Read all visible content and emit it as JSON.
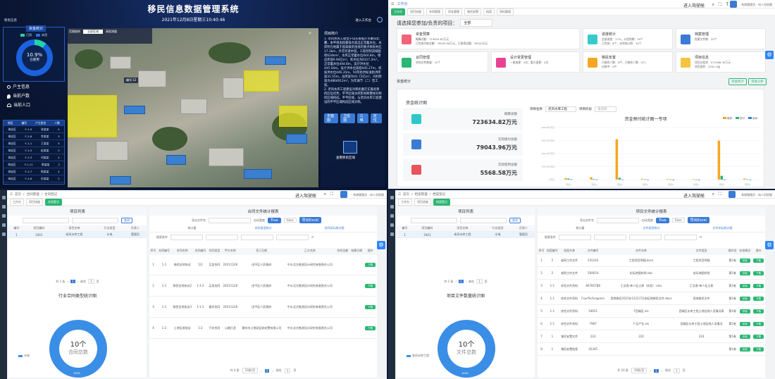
{
  "q1": {
    "title": "移民信息数据管理系统",
    "datetime": "2021年12月8日星期三10:40:46",
    "top_left": "移民信息",
    "top_right": "进入工作台",
    "fund_title": "资金统计",
    "legend_a": "已用",
    "legend_b": "未用",
    "pct": "10.9%",
    "pct_label": "已使用",
    "nav": [
      "户主信息",
      "当前户数",
      "当前人口"
    ],
    "table_head": [
      "地区",
      "编号",
      "户主姓名",
      "人数"
    ],
    "table_rows": [
      [
        "海淀区",
        "F-1-9",
        "张某某",
        "4"
      ],
      [
        "海淀区",
        "F-1-8",
        "李某某",
        "3"
      ],
      [
        "海淀区",
        "F-1-1",
        "王某某",
        "5"
      ],
      [
        "海淀区",
        "F-1-5",
        "赵某某",
        "3"
      ],
      [
        "海淀区",
        "F-1-3",
        "刘某某",
        "4"
      ],
      [
        "海淀区",
        "F-1-11",
        "陈某某",
        "2"
      ],
      [
        "海淀区",
        "F-1-7",
        "杨某某",
        "4"
      ],
      [
        "海淀区",
        "F-1-6",
        "孙某某",
        "3"
      ]
    ],
    "map_controls": [
      "范围图例",
      "全部区域",
      "高程测量"
    ],
    "map_label": "编号:12",
    "text_title": "项目简介",
    "text_body": "1. 老风水库工程位于山东省临沂市蒙山北麓，本平坝高程最低点高出正常蓄水位，水库所在地属于国家级贫困县的重点移民村庄17.3km，外完河道中游。工程控制流域面积624km²，水库正常蓄水位444.8m，相应库容0.94亿m³，死水位为6317.2m³，正常蓄水位444.8m，设计洪水位445.54m，设计洪水位高程445.27m，校核洪水位446.35m。50年防洪标准防洪库容31.55m，总库容为41.72亿m³，兴利库容为4864912m³，为年调节（二）型工程。\n2. 老风水库工程建设对移民搬迁实施北移的区位优势，平平区域水库影响和整体对称的区域构成，平平区域，与老风水库工程建设的平平区域构成区域对称。",
    "buttons": [
      "平面图",
      "卫星图",
      "三维",
      "定位"
    ],
    "bottom_btn": "查看移民区域"
  },
  "q2": {
    "header_right": "进入驾驶舱",
    "user": "系统管理员 · 向人员权限",
    "tabs": [
      "工作台",
      "项目进度",
      "合同管理",
      "资金管理",
      "移民安置",
      "档案",
      "资料管理"
    ],
    "select_label": "请选择您参加/负责的项目：",
    "select_value": "全部",
    "stat_cards": [
      {
        "title": "资金预算",
        "lines": [
          "概算总额：723634.82万元",
          "已完成付款总额：79043.96万元，已使用总额：39100万元"
        ],
        "color": "#f2637b"
      },
      {
        "title": "进度统计",
        "lines": [
          "全部进度：17%，计划到期：29个",
          "已完成：8个，未完成计划：34个"
        ],
        "color": "#36cbcb"
      },
      {
        "title": "档案管理",
        "lines": [
          "档案文件数：10个"
        ],
        "color": "#3a7bd5"
      },
      {
        "title": "合同管理",
        "lines": [
          "合同文件数量：10个"
        ],
        "color": "#2bb673"
      },
      {
        "title": "设计变更管理",
        "lines": [
          "一般变更：0次；重大变更：0次"
        ],
        "color": "#e84393"
      },
      {
        "title": "移民安置",
        "lines": [
          "已移民人数：0户，已移民人数：0人；",
          "迁移中：0户"
        ],
        "color": "#f5a623"
      },
      {
        "title": "项目信息",
        "lines": [
          "项目总投资：571066.30万元",
          "项目面积：2050.1亩"
        ],
        "color": "#f5c342"
      }
    ],
    "section": "资金统计",
    "section_tabs": [
      "资金统计",
      "资金分析"
    ],
    "panel_title": "资金统计图",
    "metrics": [
      {
        "label": "概算总额",
        "value": "723634.82万元",
        "color": "#2ec7c9"
      },
      {
        "label": "实际拨付总额",
        "value": "79043.96万元",
        "color": "#3a7bd5"
      },
      {
        "label": "实际使用总额",
        "value": "5568.58万元",
        "color": "#e8545c"
      }
    ],
    "filter1_label": "项目名称",
    "filter1_value": "老风水库工程",
    "filter2_label": "项目阶段",
    "filter2_value": "请选择"
  },
  "chart_data": {
    "type": "bar",
    "title": "资金预付统计图一专项",
    "series": [
      {
        "name": "概算",
        "color": "#f5a623"
      },
      {
        "name": "拨付",
        "color": "#2bb673"
      },
      {
        "name": "使用",
        "color": "#3a7bd5"
      }
    ],
    "ylim": [
      0,
      400000
    ],
    "yticks": [
      "400,000万元",
      "300,000万元",
      "200,000万元",
      "100,000万元",
      "0万元"
    ],
    "groups": [
      {
        "label": "项目1",
        "values": [
          12000,
          8000,
          2000
        ]
      },
      {
        "label": "项目2",
        "values": [
          18000,
          5000,
          1500
        ]
      },
      {
        "label": "项目3",
        "values": [
          310000,
          15000,
          2000
        ]
      },
      {
        "label": "项目4",
        "values": [
          6000,
          3000,
          800
        ]
      },
      {
        "label": "项目5",
        "values": [
          5000,
          2000,
          600
        ]
      },
      {
        "label": "项目6",
        "values": [
          4000,
          1500,
          500
        ]
      },
      {
        "label": "项目7",
        "values": [
          300000,
          30000,
          1800
        ]
      },
      {
        "label": "项目8",
        "values": [
          8000,
          3000,
          800
        ]
      }
    ]
  },
  "q3": {
    "header_right": "进入驾驶舱",
    "user": "系统管理员 · 向人员权限",
    "breadcrumb": [
      "首页",
      "合同管理",
      "合同登记"
    ],
    "tabs": [
      "工作台",
      "项目进度",
      "合同登记"
    ],
    "left_title": "项目列表",
    "left_cols": [
      "编号",
      "项目编码",
      "项目名称",
      "行业类型",
      "负责人"
    ],
    "left_row": [
      "1",
      "1001",
      "老风水库工程",
      "水电",
      "管理员"
    ],
    "pager_total": "共 1 条",
    "pager_page": "1",
    "pager_size": "10条/页",
    "pager_goto": "前往",
    "pager_go_page": "1",
    "pager_unit": "页",
    "search_btn": "查询",
    "left_chart_title": "行业合同类型统计图",
    "left_legend": "水电",
    "donut_num": "10个",
    "donut_label": "合同总数",
    "donut_pct": "100%",
    "right_title": "合同文件统计报表",
    "export_label": "导出文件名",
    "auto_width": "自动宽度",
    "btn_true": "True",
    "btn_false": "False",
    "btn_export": "导出Excel",
    "subtabs": [
      "统计量",
      "合同类型统计"
    ],
    "right_link": "合同实际统计图",
    "search_label": "搜索条件",
    "cols": [
      "序号",
      "合同编号",
      "合同名称",
      "合同编号",
      "合同类型",
      "甲方名称",
      "签订日期",
      "乙方名称",
      "合同金额",
      "结算日期",
      "操作"
    ],
    "rows": [
      [
        "1",
        "1-1",
        "移民征地协议",
        "5/1",
        "买卖合同",
        "2021/12/8",
        "由平区人民政府",
        "中水北方勘测设计研究有限责任公司"
      ],
      [
        "2",
        "1-1",
        "移民征地协议2",
        "1-1-2",
        "买卖合同",
        "2021/12/8",
        "由平区人民政府",
        "中水北方勘测设计研究有限责任公司"
      ],
      [
        "3",
        "1-1",
        "移民征地协议3",
        "1-1-2",
        "委托合同",
        "2021/12/8",
        "由平区人民政府",
        "中水北方勘测设计研究有限责任公司"
      ],
      [
        "4",
        "1-2",
        "土地征收协议",
        "1-2",
        "汽车合同",
        "公路打造",
        "潮州市土地局征收安置有限公司",
        "中水北方勘测设计研究有限责任公司"
      ]
    ],
    "op": "下载",
    "bottom_total": "共 4 条",
    "bottom_size": "10条/页",
    "bottom_page": "1",
    "bottom_goto": "前往",
    "bottom_go_page": "1",
    "bottom_unit": "页"
  },
  "q4": {
    "header_right": "进入驾驶舱",
    "user": "系统管理员 · 向人员权限",
    "breadcrumb": [
      "首页",
      "档案管理",
      "档案登记"
    ],
    "tabs": [
      "工作台",
      "项目进度",
      "档案登记"
    ],
    "left_title": "项目列表",
    "left_cols": [
      "编号",
      "项目编码",
      "项目名称",
      "行业类型",
      "负责人"
    ],
    "left_row": [
      "1",
      "1001",
      "老风水库工程",
      "水电",
      "管理员"
    ],
    "pager_total": "共 1 条",
    "pager_page": "1",
    "pager_size": "10条/页",
    "pager_goto": "前往",
    "pager_go_page": "1",
    "pager_unit": "页",
    "search_btn": "查询",
    "left_chart_title": "项目文件数量统计图",
    "left_legend": "老风水库工程",
    "donut_num": "10个",
    "donut_label": "文件总数",
    "donut_pct": "100%",
    "right_title": "项目文件统计报表",
    "export_label": "导出文件名",
    "auto_width": "自动宽度",
    "btn_true": "True",
    "btn_false": "False",
    "btn_export": "导出Excel",
    "subtabs": [
      "统计量",
      "文件类型统计"
    ],
    "right_link": "文件实际统计图",
    "search_label": "搜索条件",
    "cols": [
      "序号",
      "档案编号",
      "档案名称",
      "文件编号",
      "文件名称",
      "文件类型",
      "操作员",
      "存档情况",
      "操作"
    ],
    "rows": [
      [
        "1",
        "2",
        "老网工作文件",
        "231243",
        "工程项目明细.docx",
        "工程项目明细",
        "第1卷",
        "存档"
      ],
      [
        "2",
        "2",
        "老网工作文件",
        "564654",
        "实际地图样例.doc",
        "实际地图样例",
        "第1卷",
        "存档"
      ],
      [
        "3",
        "1-1",
        "综合文件资料",
        "66785788",
        "汇总表-单人征占表（实发）.xlsx",
        "汇总表-单人征占表",
        "第1卷",
        "存档"
      ],
      [
        "4",
        "1-1",
        "综合文件资料",
        "Fsucfhcfungsmn",
        "用地移民2021年12月17日前征地移民文件.docx",
        "用地移民文件",
        "第1卷",
        "存档"
      ],
      [
        "5",
        "1-1",
        "综合文件资料",
        "54651",
        "F西城区.xls",
        "西城区水库工程土地征地人员情况表",
        "第1卷",
        "存档"
      ],
      [
        "6",
        "1-1",
        "综合文件资料",
        "7987",
        "F 区产业.xls",
        "西城区水库工程土地征地人员情况",
        "第1卷",
        "存档"
      ],
      [
        "7",
        "1",
        "移民安置文件",
        "224",
        "224",
        "224",
        "第1卷",
        "存档"
      ],
      [
        "8",
        "1",
        "移民安置档案",
        "45345",
        "",
        "",
        "第1卷",
        "存档"
      ]
    ],
    "op": "下载",
    "bottom_total": "共 10 条",
    "bottom_size": "10条/页",
    "bottom_page": "1",
    "bottom_goto": "前往",
    "bottom_go_page": "1",
    "bottom_unit": "页"
  }
}
